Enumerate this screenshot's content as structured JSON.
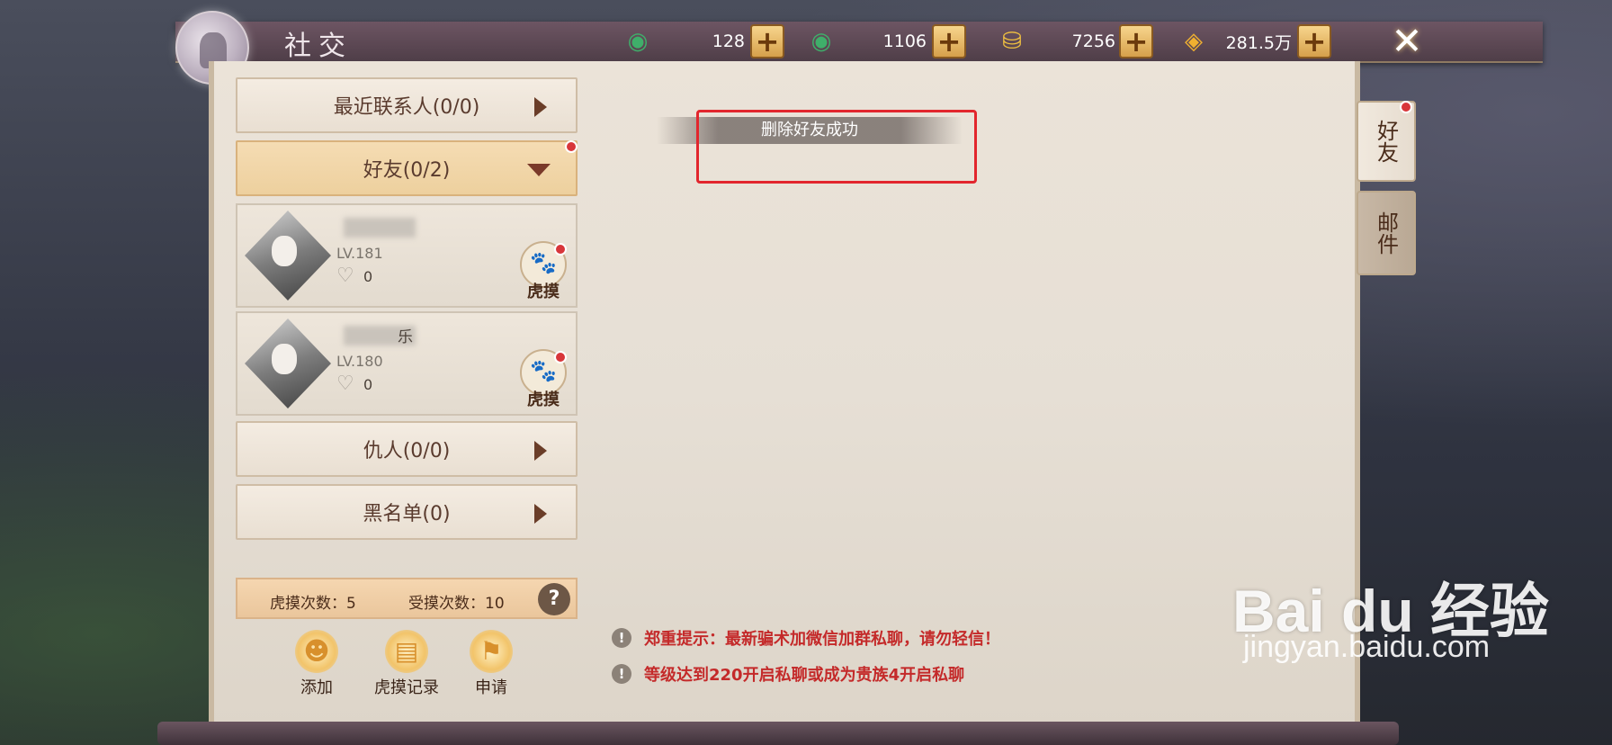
{
  "window": {
    "title": "社交"
  },
  "currencies": [
    {
      "icon": "jade-icon",
      "value": "128"
    },
    {
      "icon": "bound-jade-icon",
      "value": "1106"
    },
    {
      "icon": "gold-ingot-icon",
      "value": "7256"
    },
    {
      "icon": "coin-icon",
      "value": "281.5万"
    }
  ],
  "categories": {
    "recent": "最近联系人(0/0)",
    "friends": "好友(0/2)",
    "enemies": "仇人(0/0)",
    "blacklist": "黑名单(0)"
  },
  "friends": [
    {
      "name": "",
      "level": "LV.181",
      "hearts": "0",
      "action": "虎摸"
    },
    {
      "name": "乐",
      "level": "LV.180",
      "hearts": "0",
      "action": "虎摸"
    }
  ],
  "stats": {
    "pat_count": "虎摸次数：5",
    "patted_count": "受摸次数：10",
    "help": "?"
  },
  "actions": {
    "add": "添加",
    "record": "虎摸记录",
    "apply": "申请"
  },
  "toast": "删除好友成功",
  "tips": [
    "郑重提示：最新骗术加微信加群私聊，请勿轻信！",
    "等级达到220开启私聊或成为贵族4开启私聊"
  ],
  "side_tabs": {
    "friends": "好友",
    "mail": "邮件"
  },
  "watermark": {
    "brand": "Bai du 经验",
    "url": "jingyan.baidu.com"
  },
  "colors": {
    "highlight": "#e2262d",
    "tip_text": "#c42a2a",
    "badge": "#d8363a"
  }
}
